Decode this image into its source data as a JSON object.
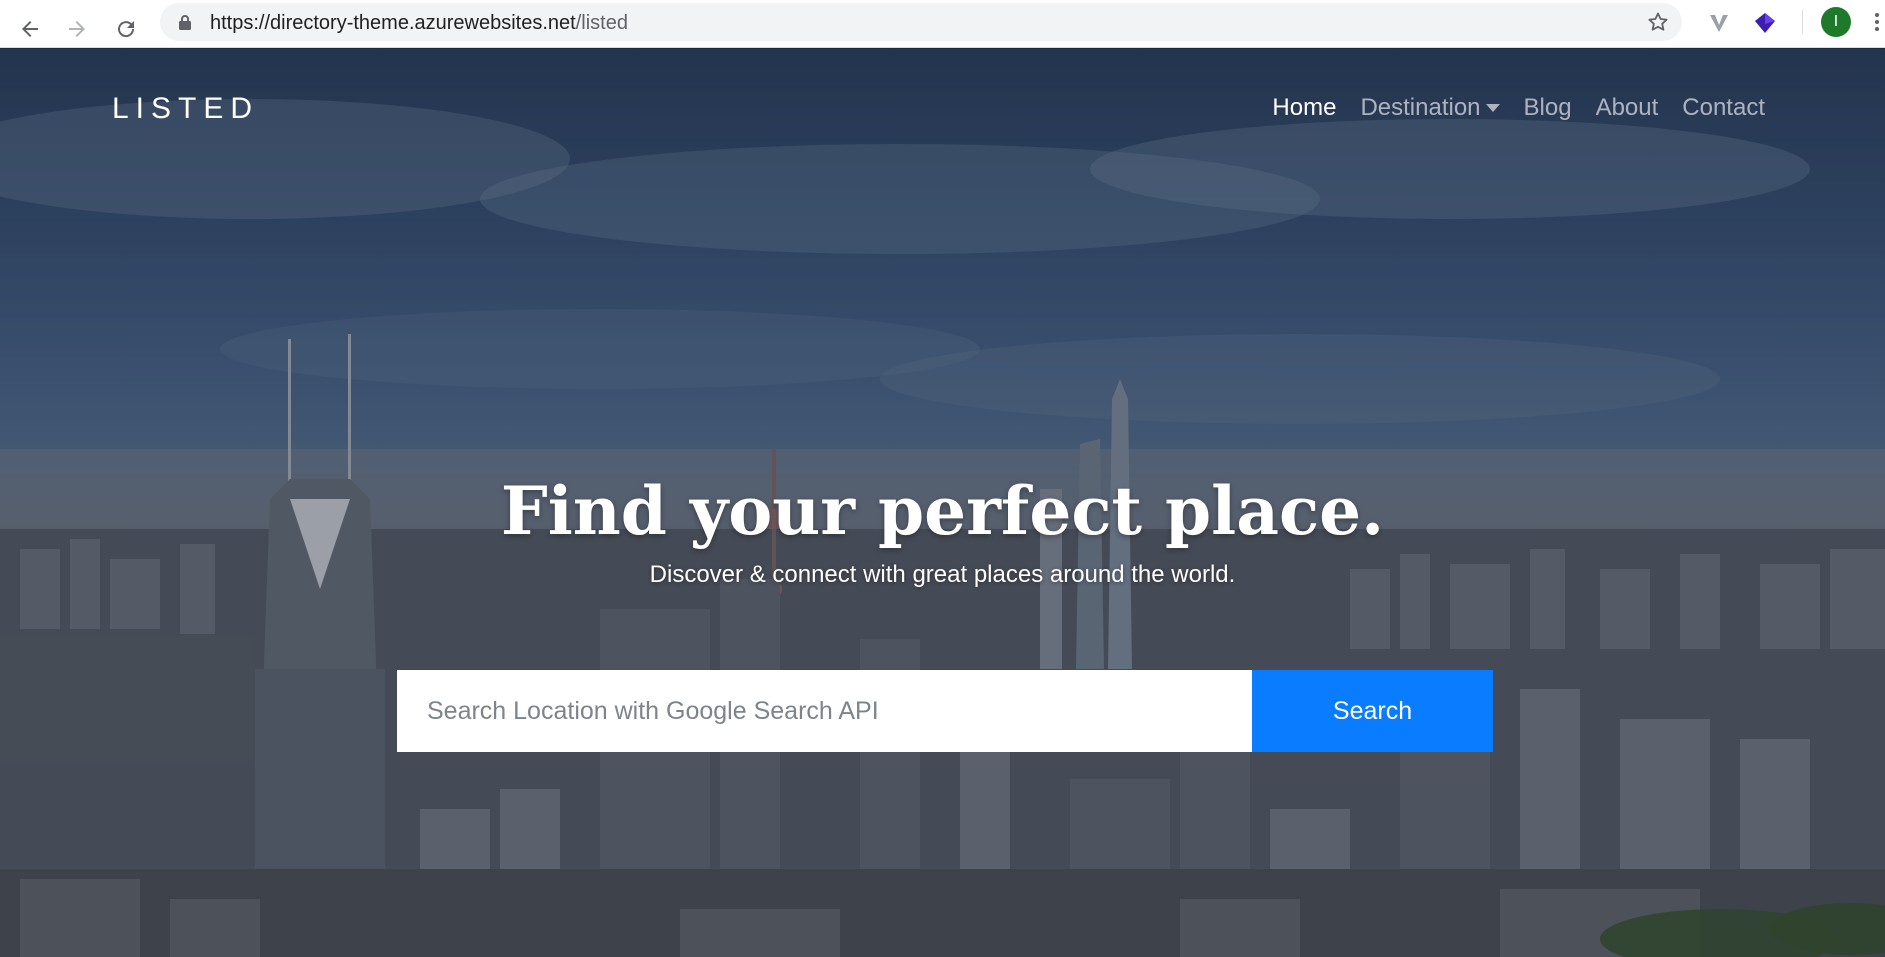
{
  "browser": {
    "url_host": "https://directory-theme.azurewebsites.net",
    "url_path": "/listed",
    "profile_initial": "I"
  },
  "site": {
    "brand": "LISTED",
    "nav": [
      {
        "label": "Home",
        "active": true
      },
      {
        "label": "Destination",
        "dropdown": true
      },
      {
        "label": "Blog"
      },
      {
        "label": "About"
      },
      {
        "label": "Contact"
      }
    ]
  },
  "hero": {
    "headline": "Find your perfect place.",
    "subline": "Discover & connect with great places around the world.",
    "search_placeholder": "Search Location with Google Search API",
    "search_button": "Search"
  },
  "colors": {
    "primary": "#0a7cff",
    "profile": "#1e7a2a"
  }
}
